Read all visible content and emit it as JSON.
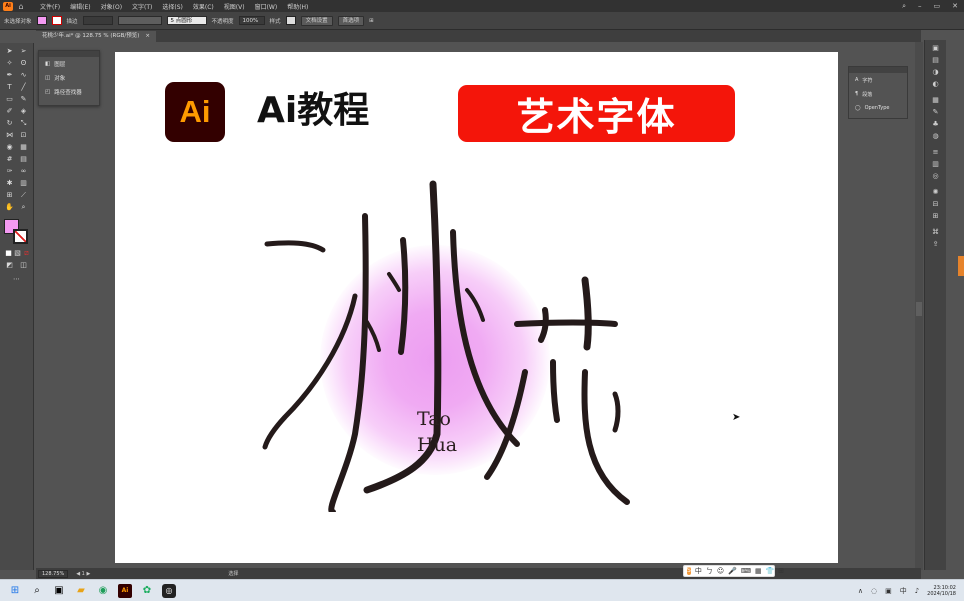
{
  "menubar": {
    "items": [
      "文件(F)",
      "编辑(E)",
      "对象(O)",
      "文字(T)",
      "选择(S)",
      "效果(C)",
      "视图(V)",
      "窗口(W)",
      "帮助(H)"
    ]
  },
  "control": {
    "selection_label": "未选择对象",
    "stroke_label": "描边",
    "point_label": "5 点圆形",
    "opacity_label": "不透明度",
    "opacity_value": "100%",
    "style_label": "样式",
    "doc_setup": "文档设置",
    "prefs": "首选项"
  },
  "tab": {
    "title": "花桃少年.ai* @ 128.75 % (RGB/预览)",
    "close": "×"
  },
  "layers": {
    "items": [
      "图层",
      "对象",
      "路径查找器"
    ]
  },
  "artboard": {
    "ai_logo": "Ai",
    "title": "Ai教程",
    "banner": "艺术字体",
    "latin_line1": "Tao",
    "latin_line2": "Hua"
  },
  "props": {
    "items": [
      "字符",
      "段落",
      "OpenType"
    ]
  },
  "status": {
    "zoom": "128.75%",
    "selection": "选择"
  },
  "ime": {
    "items": [
      "S",
      "中",
      "ㄅ",
      "☺",
      "🎤",
      "⌨",
      "▦",
      "👕",
      "⊞"
    ]
  },
  "taskbar": {
    "time": "23:10:02",
    "date": "2024/10/18"
  },
  "colors": {
    "fill": "#f49af2",
    "banner": "#f4150a",
    "ai_bg": "#330000",
    "ai_fg": "#ff9a00",
    "glow": "#ec9df1"
  }
}
